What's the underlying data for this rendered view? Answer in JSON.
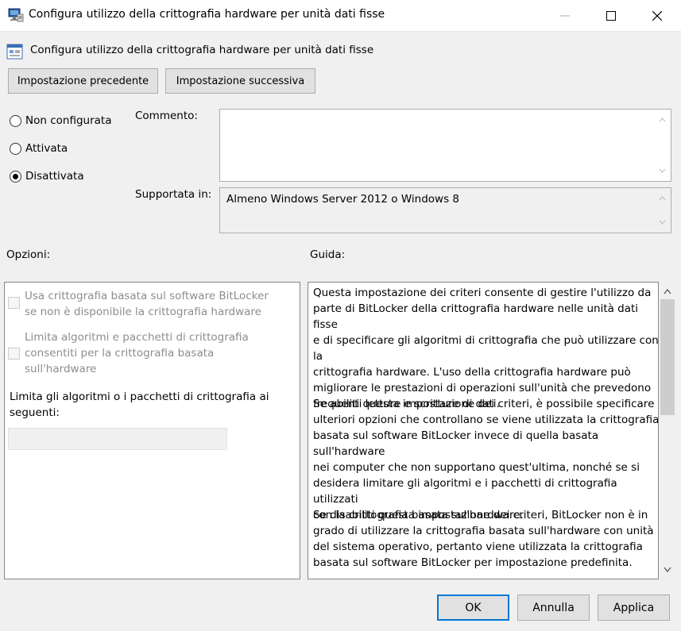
{
  "window": {
    "title": "Configura utilizzo della crittografia hardware per unità dati fisse"
  },
  "header": {
    "title": "Configura utilizzo della crittografia hardware per unità dati fisse"
  },
  "nav": {
    "previous_label": "Impostazione precedente",
    "next_label": "Impostazione successiva"
  },
  "state": {
    "options": [
      "Non configurata",
      "Attivata",
      "Disattivata"
    ],
    "selected": "Disattivata"
  },
  "comment": {
    "label": "Commento:",
    "value": ""
  },
  "supported": {
    "label": "Supportata in:",
    "value": "Almeno Windows Server 2012 o Windows 8"
  },
  "options_panel": {
    "label": "Opzioni:",
    "checkbox_software_fallback": "Usa crittografia basata sul software BitLocker\nse non è disponibile la crittografia hardware",
    "checkbox_restrict_algorithms": "Limita algoritmi e pacchetti di crittografia\nconsentiti per la crittografia basata\nsull'hardware",
    "restrict_label": "Limita gli algoritmi o i pacchetti di crittografia ai\nseguenti:",
    "restrict_value": ""
  },
  "guide": {
    "label": "Guida:",
    "paragraph1": "Questa impostazione dei criteri consente di gestire l'utilizzo da\nparte di BitLocker della crittografia hardware nelle unità dati fisse\ne di specificare gli algoritmi di crittografia che può utilizzare con la\ncrittografia hardware. L'uso della crittografia hardware può\nmigliorare le prestazioni di operazioni sull'unità che prevedono\nfrequenti letture e scritture di dati.",
    "paragraph2": "Se abiliti questa impostazione dei criteri, è possibile specificare\nulteriori opzioni che controllano se viene utilizzata la crittografia\nbasata sul software BitLocker invece di quella basata sull'hardware\nnei computer che non supportano quest'ultima, nonché se si\ndesidera limitare gli algoritmi e i pacchetti di crittografia utilizzati\ncon la crittografia basata sul'hardware.",
    "paragraph3": "Se disabiliti questa impostazione dei criteri, BitLocker non è in\ngrado di utilizzare la crittografia basata sull'hardware con unità\ndel sistema operativo, pertanto viene utilizzata la crittografia\nbasata sul software BitLocker per impostazione predefinita."
  },
  "footer": {
    "ok_label": "OK",
    "cancel_label": "Annulla",
    "apply_label": "Applica"
  },
  "colors": {
    "accent": "#0078d7",
    "dialog_background": "#f0f0f0"
  }
}
